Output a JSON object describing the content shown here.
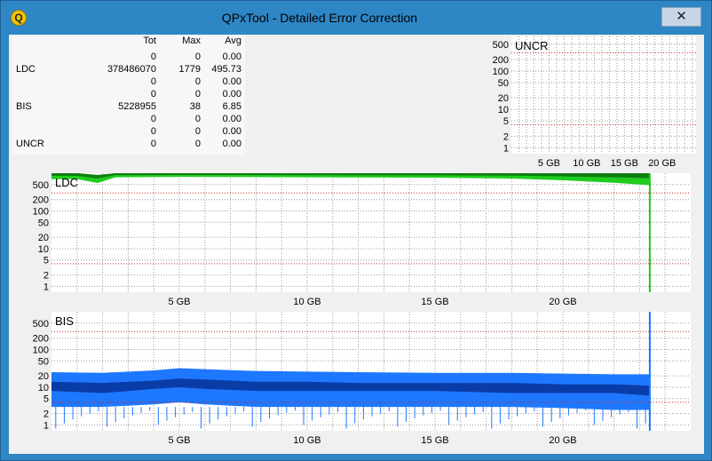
{
  "window": {
    "title": "QPxTool - Detailed Error Correction",
    "close_symbol": "✕",
    "app_icon_glyph": "Q"
  },
  "stats": {
    "headers": [
      "Tot",
      "Max",
      "Avg"
    ],
    "rows": [
      {
        "label": "",
        "tot": "0",
        "max": "0",
        "avg": "0.00"
      },
      {
        "label": "LDC",
        "tot": "378486070",
        "max": "1779",
        "avg": "495.73"
      },
      {
        "label": "",
        "tot": "0",
        "max": "0",
        "avg": "0.00"
      },
      {
        "label": "",
        "tot": "0",
        "max": "0",
        "avg": "0.00"
      },
      {
        "label": "BIS",
        "tot": "5228955",
        "max": "38",
        "avg": "6.85"
      },
      {
        "label": "",
        "tot": "0",
        "max": "0",
        "avg": "0.00"
      },
      {
        "label": "",
        "tot": "0",
        "max": "0",
        "avg": "0.00"
      },
      {
        "label": "UNCR",
        "tot": "0",
        "max": "0",
        "avg": "0.00"
      }
    ]
  },
  "chart_data": [
    {
      "type": "area",
      "id": "uncr",
      "title": "UNCR",
      "x_tick_labels": [
        "5 GB",
        "10 GB",
        "15 GB",
        "20 GB"
      ],
      "x_ticks": [
        5,
        10,
        15,
        20
      ],
      "xlim": [
        0,
        24.5
      ],
      "y_tick_labels": [
        "500",
        "200",
        "100",
        "50",
        "20",
        "10",
        "5",
        "2",
        "1"
      ],
      "y_ticks": [
        500,
        200,
        100,
        50,
        20,
        10,
        5,
        2,
        1
      ],
      "y_scale": "log",
      "ylim": [
        0.7,
        800
      ],
      "threshold_lines": [
        300,
        4
      ],
      "series": [
        {
          "values": []
        }
      ],
      "colors": {
        "line": "#1fb81f",
        "threshold": "#cc2222"
      }
    },
    {
      "type": "area",
      "id": "ldc",
      "title": "LDC",
      "x_tick_labels": [
        "5 GB",
        "10 GB",
        "15 GB",
        "20 GB"
      ],
      "x_ticks": [
        5,
        10,
        15,
        20
      ],
      "xlim": [
        0,
        25
      ],
      "y_tick_labels": [
        "500",
        "200",
        "100",
        "50",
        "20",
        "10",
        "5",
        "2",
        "1"
      ],
      "y_ticks": [
        500,
        200,
        100,
        50,
        20,
        10,
        5,
        2,
        1
      ],
      "y_scale": "log",
      "ylim": [
        0.7,
        1000
      ],
      "threshold_lines": [
        300,
        4
      ],
      "end_x": 23.4,
      "series": [
        {
          "x": [
            0,
            1,
            1.8,
            2.5,
            5,
            10,
            15,
            18,
            20,
            22,
            23.4
          ],
          "upper": [
            1000,
            1000,
            900,
            1000,
            1000,
            1000,
            1000,
            1000,
            1000,
            1000,
            1000
          ],
          "lower": [
            700,
            700,
            550,
            780,
            800,
            780,
            760,
            720,
            650,
            560,
            480
          ]
        }
      ],
      "colors": {
        "outer": "#1fcc1f",
        "inner": "#0f7d0f",
        "threshold": "#cc2222"
      }
    },
    {
      "type": "area",
      "id": "bis",
      "title": "BIS",
      "x_tick_labels": [
        "5 GB",
        "10 GB",
        "15 GB",
        "20 GB"
      ],
      "x_ticks": [
        5,
        10,
        15,
        20
      ],
      "xlim": [
        0,
        25
      ],
      "y_tick_labels": [
        "500",
        "200",
        "100",
        "50",
        "20",
        "10",
        "5",
        "2",
        "1"
      ],
      "y_ticks": [
        500,
        200,
        100,
        50,
        20,
        10,
        5,
        2,
        1
      ],
      "y_scale": "log",
      "ylim": [
        0.7,
        1000
      ],
      "threshold_lines": [
        300,
        4
      ],
      "end_x": 23.4,
      "series": [
        {
          "x": [
            0,
            2,
            4,
            5,
            6,
            8,
            10,
            12,
            15,
            18,
            20,
            22,
            23.4
          ],
          "upper": [
            25,
            24,
            28,
            32,
            30,
            27,
            26,
            25,
            24,
            24,
            23,
            22,
            22
          ],
          "mid_hi": [
            14,
            13,
            15,
            17,
            16,
            14,
            14,
            13,
            13,
            13,
            12,
            12,
            11
          ],
          "mid_lo": [
            8,
            7,
            9,
            10,
            9,
            8,
            8,
            8,
            8,
            7,
            7,
            7,
            6
          ],
          "lower": [
            3,
            3,
            3.5,
            4,
            3.5,
            3,
            3,
            3,
            3,
            3,
            2.8,
            2.5,
            2.5
          ]
        }
      ],
      "colors": {
        "outer": "#1e78ff",
        "inner": "#0a3ca8",
        "threshold": "#cc2222"
      }
    }
  ]
}
